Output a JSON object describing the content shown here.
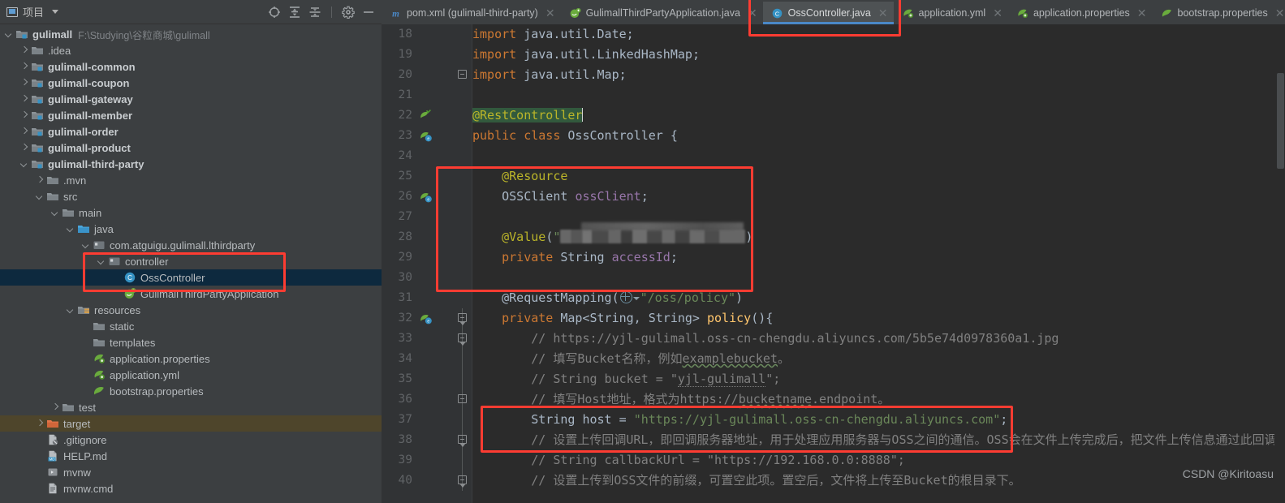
{
  "window": {
    "theme_bg": "#3c3f41",
    "editor_bg": "#2b2b2b",
    "accent": "#4a88c7",
    "annotation_color": "#fd3c32"
  },
  "project_panel": {
    "title": "项目",
    "toolbar": [
      {
        "name": "select-opened-file-icon",
        "label": "Select Opened File"
      },
      {
        "name": "expand-all-icon",
        "label": "Expand All"
      },
      {
        "name": "collapse-all-icon",
        "label": "Collapse All"
      },
      {
        "name": "settings-gear-icon",
        "label": "Settings"
      },
      {
        "name": "hide-icon",
        "label": "Hide"
      }
    ],
    "tree": [
      {
        "label": "gulimall",
        "secondary": "F:\\Studying\\谷粒商城\\gulimall",
        "indent": 0,
        "arrow": "down",
        "icon": "module-folder",
        "bold": true
      },
      {
        "label": ".idea",
        "secondary": "",
        "indent": 1,
        "arrow": "right",
        "icon": "folder",
        "bold": false
      },
      {
        "label": "gulimall-common",
        "secondary": "",
        "indent": 1,
        "arrow": "right",
        "icon": "module-folder",
        "bold": true
      },
      {
        "label": "gulimall-coupon",
        "secondary": "",
        "indent": 1,
        "arrow": "right",
        "icon": "module-folder",
        "bold": true
      },
      {
        "label": "gulimall-gateway",
        "secondary": "",
        "indent": 1,
        "arrow": "right",
        "icon": "module-folder",
        "bold": true
      },
      {
        "label": "gulimall-member",
        "secondary": "",
        "indent": 1,
        "arrow": "right",
        "icon": "module-folder",
        "bold": true
      },
      {
        "label": "gulimall-order",
        "secondary": "",
        "indent": 1,
        "arrow": "right",
        "icon": "module-folder",
        "bold": true
      },
      {
        "label": "gulimall-product",
        "secondary": "",
        "indent": 1,
        "arrow": "right",
        "icon": "module-folder",
        "bold": true
      },
      {
        "label": "gulimall-third-party",
        "secondary": "",
        "indent": 1,
        "arrow": "down",
        "icon": "module-folder",
        "bold": true
      },
      {
        "label": ".mvn",
        "secondary": "",
        "indent": 2,
        "arrow": "right",
        "icon": "folder",
        "bold": false
      },
      {
        "label": "src",
        "secondary": "",
        "indent": 2,
        "arrow": "down",
        "icon": "folder",
        "bold": false
      },
      {
        "label": "main",
        "secondary": "",
        "indent": 3,
        "arrow": "down",
        "icon": "folder",
        "bold": false
      },
      {
        "label": "java",
        "secondary": "",
        "indent": 4,
        "arrow": "down",
        "icon": "source-folder",
        "bold": false
      },
      {
        "label": "com.atguigu.gulimall.lthirdparty",
        "secondary": "",
        "indent": 5,
        "arrow": "down",
        "icon": "package",
        "bold": false
      },
      {
        "label": "controller",
        "secondary": "",
        "indent": 6,
        "arrow": "down",
        "icon": "package",
        "bold": false
      },
      {
        "label": "OssController",
        "secondary": "",
        "indent": 7,
        "arrow": "none",
        "icon": "java-class",
        "bold": false,
        "selected": true
      },
      {
        "label": "GulimallThirdPartyApplication",
        "secondary": "",
        "indent": 7,
        "arrow": "none",
        "icon": "spring-class",
        "bold": false
      },
      {
        "label": "resources",
        "secondary": "",
        "indent": 4,
        "arrow": "down",
        "icon": "resources-folder",
        "bold": false
      },
      {
        "label": "static",
        "secondary": "",
        "indent": 5,
        "arrow": "none",
        "icon": "folder",
        "bold": false
      },
      {
        "label": "templates",
        "secondary": "",
        "indent": 5,
        "arrow": "none",
        "icon": "folder",
        "bold": false
      },
      {
        "label": "application.properties",
        "secondary": "",
        "indent": 5,
        "arrow": "none",
        "icon": "spring-config",
        "bold": false
      },
      {
        "label": "application.yml",
        "secondary": "",
        "indent": 5,
        "arrow": "none",
        "icon": "spring-config",
        "bold": false
      },
      {
        "label": "bootstrap.properties",
        "secondary": "",
        "indent": 5,
        "arrow": "none",
        "icon": "spring-leaf",
        "bold": false
      },
      {
        "label": "test",
        "secondary": "",
        "indent": 3,
        "arrow": "right",
        "icon": "folder",
        "bold": false
      },
      {
        "label": "target",
        "secondary": "",
        "indent": 2,
        "arrow": "right",
        "icon": "excluded-folder",
        "bold": false,
        "highlight": "target"
      },
      {
        "label": ".gitignore",
        "secondary": "",
        "indent": 2,
        "arrow": "none",
        "icon": "gitignore-file",
        "bold": false
      },
      {
        "label": "HELP.md",
        "secondary": "",
        "indent": 2,
        "arrow": "none",
        "icon": "markdown-file",
        "bold": false
      },
      {
        "label": "mvnw",
        "secondary": "",
        "indent": 2,
        "arrow": "none",
        "icon": "script-file",
        "bold": false
      },
      {
        "label": "mvnw.cmd",
        "secondary": "",
        "indent": 2,
        "arrow": "none",
        "icon": "cmd-file",
        "bold": false
      }
    ]
  },
  "editor_tabs": [
    {
      "label": "pom.xml (gulimall-third-party)",
      "icon": "maven-icon",
      "active": false,
      "closable": true
    },
    {
      "label": "GulimallThirdPartyApplication.java",
      "icon": "spring-class-icon",
      "active": false,
      "closable": true
    },
    {
      "label": "OssController.java",
      "icon": "java-class-icon",
      "active": true,
      "closable": true
    },
    {
      "label": "application.yml",
      "icon": "spring-config-icon",
      "active": false,
      "closable": true
    },
    {
      "label": "application.properties",
      "icon": "spring-config-icon",
      "active": false,
      "closable": true
    },
    {
      "label": "bootstrap.properties",
      "icon": "spring-leaf-icon",
      "active": false,
      "closable": true
    }
  ],
  "code": {
    "first_line": 18,
    "lines": [
      {
        "n": 18,
        "text": "import java.util.Date;"
      },
      {
        "n": 19,
        "text": "import java.util.LinkedHashMap;"
      },
      {
        "n": 20,
        "text": "import java.util.Map;"
      },
      {
        "n": 21,
        "text": ""
      },
      {
        "n": 22,
        "text": "@RestController"
      },
      {
        "n": 23,
        "text": "public class OssController {"
      },
      {
        "n": 24,
        "text": ""
      },
      {
        "n": 25,
        "text": "    @Resource"
      },
      {
        "n": 26,
        "text": "    OSSClient ossClient;"
      },
      {
        "n": 27,
        "text": ""
      },
      {
        "n": 28,
        "text": "    @Value(\"████████████████\")"
      },
      {
        "n": 29,
        "text": "    private String accessId;"
      },
      {
        "n": 30,
        "text": ""
      },
      {
        "n": 31,
        "text": "    @RequestMapping(\"/oss/policy\")"
      },
      {
        "n": 32,
        "text": "    private Map<String, String> policy(){"
      },
      {
        "n": 33,
        "text": "        // https://yjl-gulimall.oss-cn-chengdu.aliyuncs.com/5b5e74d0978360a1.jpg"
      },
      {
        "n": 34,
        "text": "        // 填写Bucket名称，例如examplebucket。"
      },
      {
        "n": 35,
        "text": "        // String bucket = \"yjl-gulimall\";"
      },
      {
        "n": 36,
        "text": "        // 填写Host地址，格式为https://bucketname.endpoint。"
      },
      {
        "n": 37,
        "text": "        String host = \"https://yjl-gulimall.oss-cn-chengdu.aliyuncs.com\";"
      },
      {
        "n": 38,
        "text": "        // 设置上传回调URL，即回调服务器地址，用于处理应用服务器与OSS之间的通信。OSS会在文件上传完成后，把文件上传信息通过此回调URL发送"
      },
      {
        "n": 39,
        "text": "        // String callbackUrl = \"https://192.168.0.0:8888\";"
      },
      {
        "n": 40,
        "text": "        // 设置上传到OSS文件的前缀，可置空此项。置空后，文件将上传至Bucket的根目录下。"
      }
    ]
  },
  "annotations": [
    {
      "name": "tab-highlight-box",
      "target": "OssController.java tab"
    },
    {
      "name": "resource-value-box",
      "target": "@Resource / @Value block"
    },
    {
      "name": "host-box",
      "target": "String host assignment"
    },
    {
      "name": "controller-tree-box",
      "target": "controller package and OssController"
    }
  ],
  "watermark": "CSDN @Kiritoasu"
}
